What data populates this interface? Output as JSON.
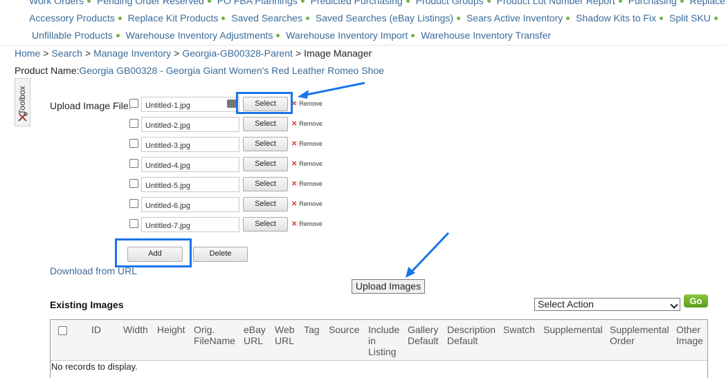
{
  "nav": {
    "row1": [
      "Work Orders",
      "Pending Order Reserved",
      "PO FBA Plannings",
      "Predicted Purchasing",
      "Product Groups",
      "Product Lot Number Report",
      "Purchasing",
      "Replace"
    ],
    "row2": [
      "Accessory Products",
      "Replace Kit Products",
      "Saved Searches",
      "Saved Searches (eBay Listings)",
      "Sears Active Inventory",
      "Shadow Kits to Fix",
      "Split SKU"
    ],
    "row3": [
      "Unfillable Products",
      "Warehouse Inventory Adjustments",
      "Warehouse Inventory Import",
      "Warehouse Inventory Transfer"
    ]
  },
  "breadcrumb": {
    "items": [
      "Home",
      "Search",
      "Manage Inventory",
      "Georgia-GB00328-Parent"
    ],
    "current": "Image Manager",
    "sep": ">"
  },
  "product": {
    "label": "Product Name:",
    "name": "Georgia GB00328 - Georgia Giant Women's Red Leather Romeo Shoe"
  },
  "toolbox": {
    "label": "Toolbox",
    "icon": "tools-icon"
  },
  "upload": {
    "label": "Upload Image File:",
    "select_label": "Select",
    "remove_label": "Remove",
    "files": [
      "Untitled-1.jpg",
      "Untitled-2.jpg",
      "Untitled-3.jpg",
      "Untitled-4.jpg",
      "Untitled-5.jpg",
      "Untitled-6.jpg",
      "Untitled-7.jpg"
    ]
  },
  "actions": {
    "add": "Add",
    "delete": "Delete",
    "download_url": "Download from URL",
    "upload_images": "Upload Images"
  },
  "existing": {
    "title": "Existing Images",
    "select_action": "Select Action",
    "go": "Go",
    "columns": [
      "ID",
      "Width",
      "Height",
      "Orig. FileName",
      "eBay URL",
      "Web URL",
      "Tag",
      "Source",
      "Include in Listing",
      "Gallery Default",
      "Description Default",
      "Swatch",
      "Supplemental",
      "Supplemental Order",
      "Other Image"
    ],
    "empty": "No records to display."
  },
  "colors": {
    "link": "#3a6b9a",
    "bullet": "#6db33f",
    "highlight": "#1a73e8",
    "go": "#6aaf2a"
  }
}
